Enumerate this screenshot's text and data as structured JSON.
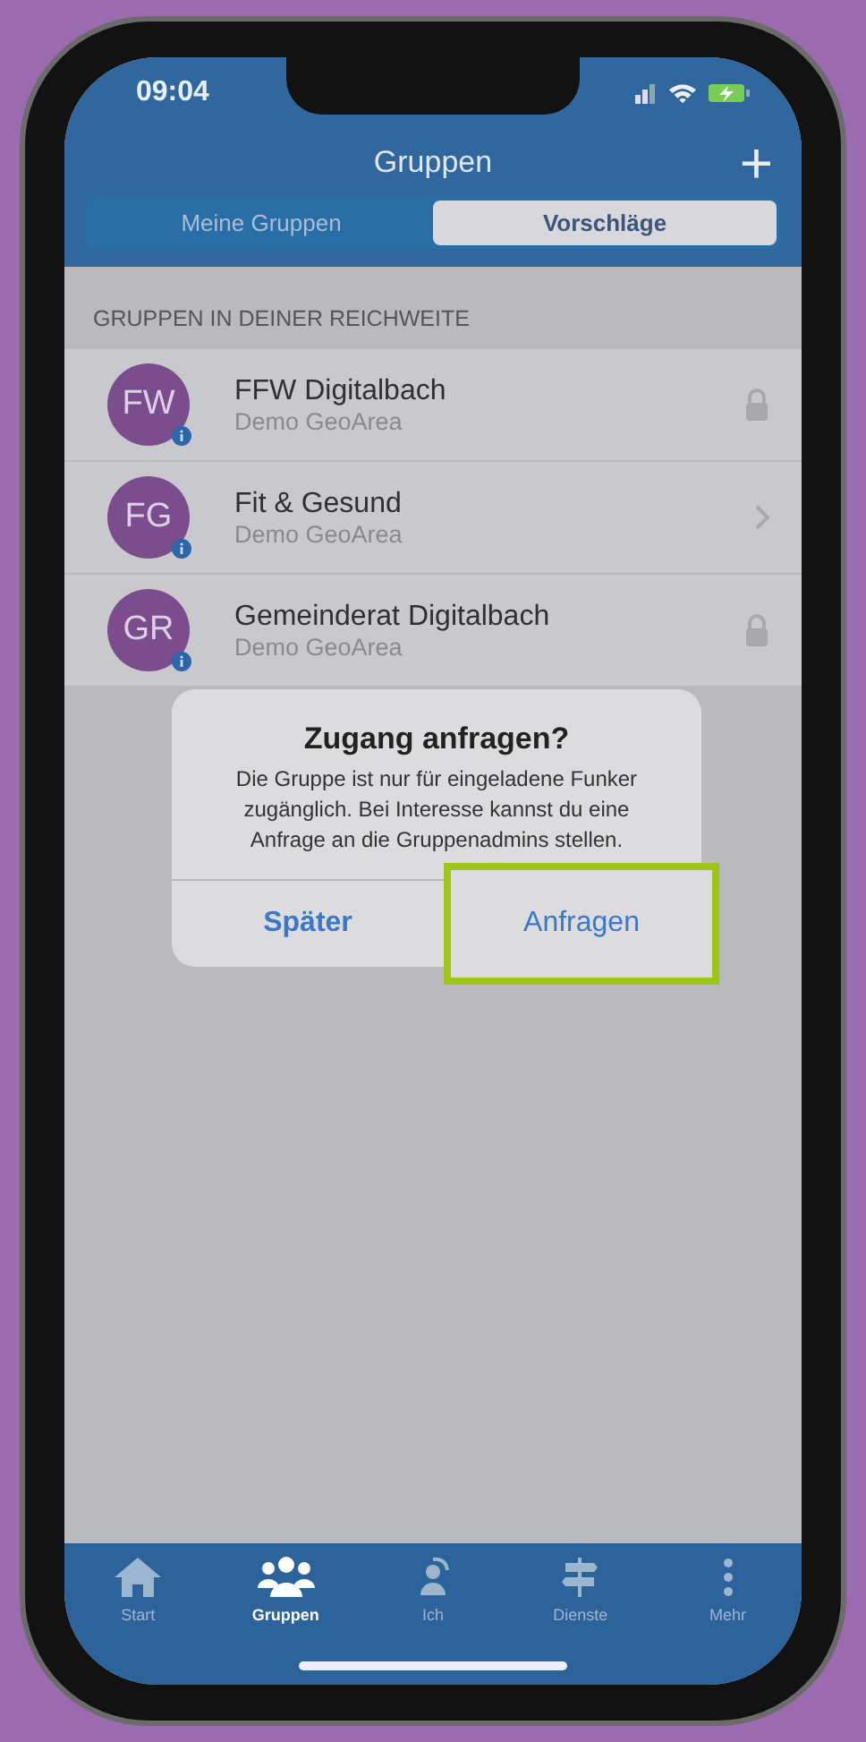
{
  "status_bar": {
    "time": "09:04"
  },
  "header": {
    "title": "Gruppen",
    "add_button": "+"
  },
  "segments": [
    {
      "label": "Meine Gruppen",
      "selected": false
    },
    {
      "label": "Vorschläge",
      "selected": true
    }
  ],
  "section": {
    "title": "GRUPPEN IN DEINER REICHWEITE"
  },
  "groups": [
    {
      "initials": "FW",
      "name": "FFW Digitalbach",
      "subtitle": "Demo GeoArea",
      "kind": "locked"
    },
    {
      "initials": "FG",
      "name": "Fit & Gesund",
      "subtitle": "Demo GeoArea",
      "kind": "open"
    },
    {
      "initials": "GR",
      "name": "Gemeinderat Digitalbach",
      "subtitle": "Demo GeoArea",
      "kind": "locked"
    }
  ],
  "dialog": {
    "title": "Zugang anfragen?",
    "message": "Die Gruppe ist nur für eingeladene Funker zugänglich. Bei Interesse kannst du eine Anfrage an die Gruppenadmins stellen.",
    "buttons": [
      {
        "label": "Später",
        "bold": true,
        "highlighted": false
      },
      {
        "label": "Anfragen",
        "bold": false,
        "highlighted": true
      }
    ]
  },
  "tab_bar": [
    {
      "label": "Start",
      "kind": "home",
      "selected": false
    },
    {
      "label": "Gruppen",
      "kind": "groups",
      "selected": true
    },
    {
      "label": "Ich",
      "kind": "person",
      "selected": false
    },
    {
      "label": "Dienste",
      "kind": "signpost",
      "selected": false
    },
    {
      "label": "Mehr",
      "kind": "more",
      "selected": false
    }
  ]
}
